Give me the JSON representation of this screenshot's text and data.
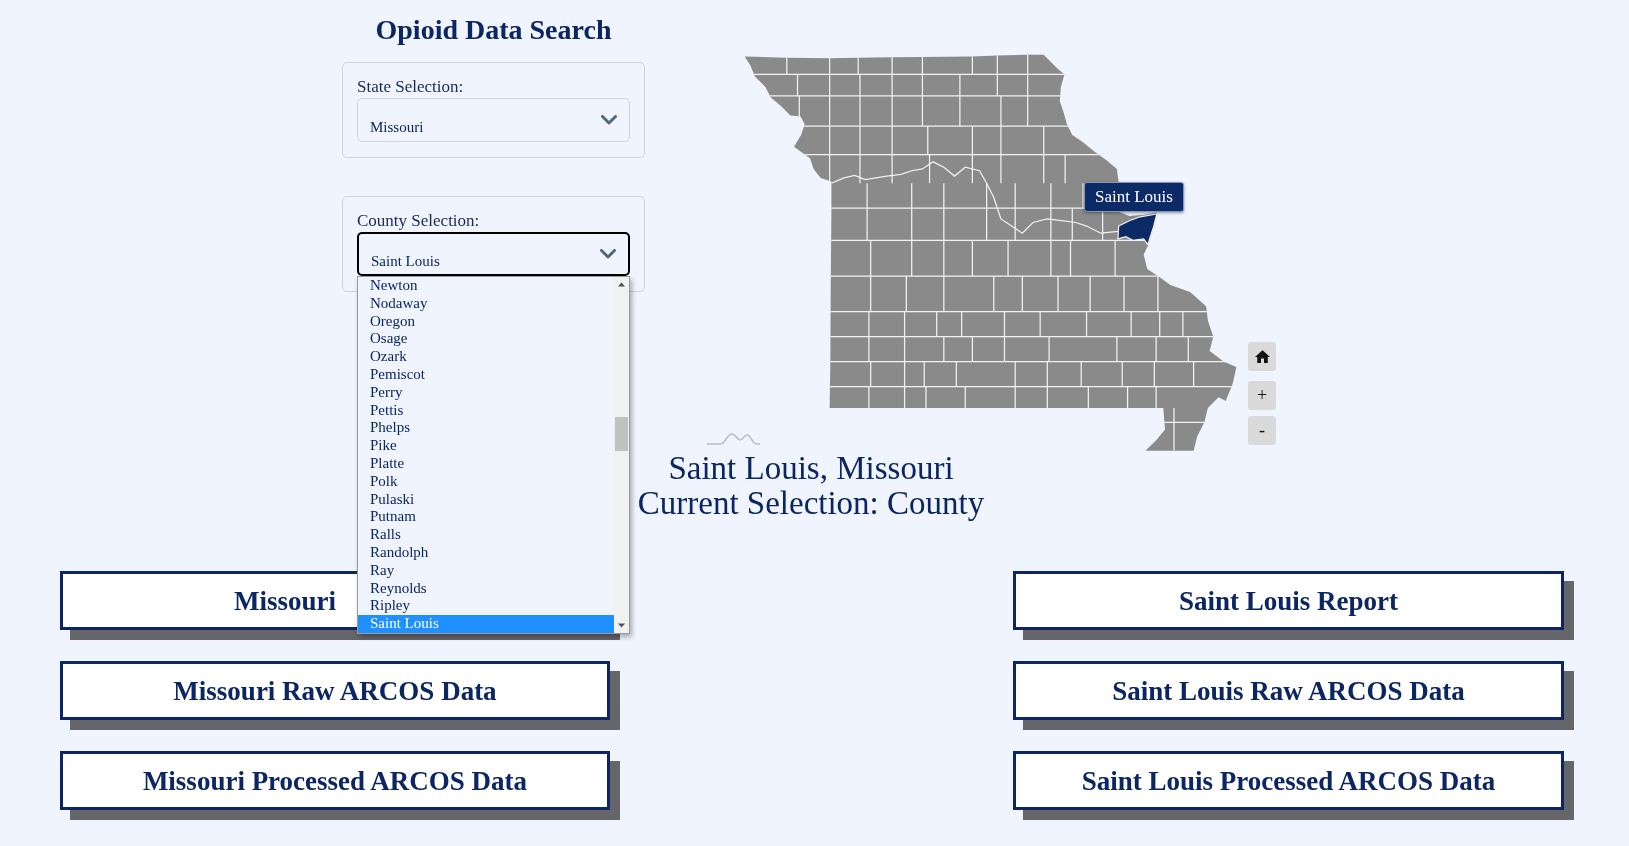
{
  "title": "Opioid Data Search",
  "state_selection": {
    "label": "State Selection:",
    "value": "Missouri",
    "focused": false
  },
  "county_selection": {
    "label": "County Selection:",
    "value": "Saint Louis",
    "focused": true,
    "expanded": true,
    "options": [
      {
        "label": "Newton",
        "selected": false
      },
      {
        "label": "Nodaway",
        "selected": false
      },
      {
        "label": "Oregon",
        "selected": false
      },
      {
        "label": "Osage",
        "selected": false
      },
      {
        "label": "Ozark",
        "selected": false
      },
      {
        "label": "Pemiscot",
        "selected": false
      },
      {
        "label": "Perry",
        "selected": false
      },
      {
        "label": "Pettis",
        "selected": false
      },
      {
        "label": "Phelps",
        "selected": false
      },
      {
        "label": "Pike",
        "selected": false
      },
      {
        "label": "Platte",
        "selected": false
      },
      {
        "label": "Polk",
        "selected": false
      },
      {
        "label": "Pulaski",
        "selected": false
      },
      {
        "label": "Putnam",
        "selected": false
      },
      {
        "label": "Ralls",
        "selected": false
      },
      {
        "label": "Randolph",
        "selected": false
      },
      {
        "label": "Ray",
        "selected": false
      },
      {
        "label": "Reynolds",
        "selected": false
      },
      {
        "label": "Ripley",
        "selected": false
      },
      {
        "label": "Saint Louis",
        "selected": true
      }
    ]
  },
  "map": {
    "tooltip": "Saint Louis",
    "highlighted": true,
    "zoom_in": "+",
    "zoom_out": "-"
  },
  "selection_summary": [
    "Saint Louis, Missouri",
    "Current Selection: County"
  ],
  "state_buttons": [
    {
      "label": "Missouri",
      "kind": "partial"
    },
    {
      "label": "Missouri Raw ARCOS Data",
      "kind": "full"
    },
    {
      "label": "Missouri Processed ARCOS Data",
      "kind": "full"
    }
  ],
  "county_buttons": [
    {
      "label": "Saint Louis Report"
    },
    {
      "label": "Saint Louis Raw ARCOS Data"
    },
    {
      "label": "Saint Louis Processed ARCOS Data"
    }
  ]
}
